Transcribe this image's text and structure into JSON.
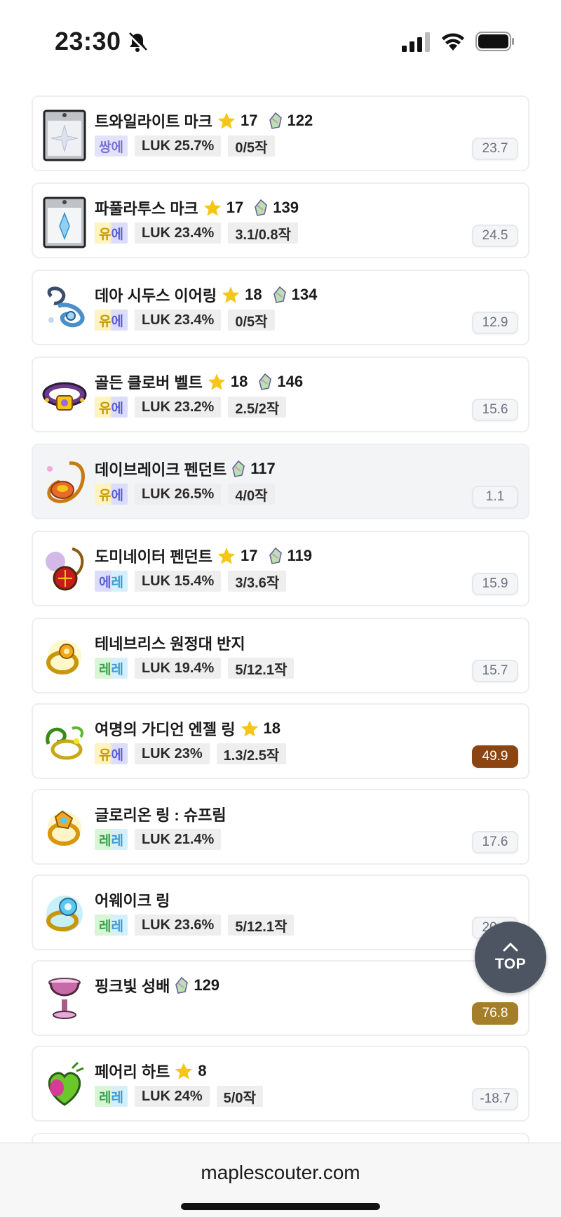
{
  "status_bar": {
    "time": "23:30"
  },
  "items": [
    {
      "name": "트와일라이트 마크",
      "star": "17",
      "gem": "122",
      "grade_a": "쌍",
      "grade_b": "에",
      "grade_class": "grade-mixed",
      "stat": "LUK 25.7%",
      "scroll": "0/5작",
      "score": "23.7",
      "score_style": "",
      "icon": "twilight-mark"
    },
    {
      "name": "파풀라투스 마크",
      "star": "17",
      "gem": "139",
      "grade_a": "유",
      "grade_b": "에",
      "grade_class": "grade-unique",
      "stat": "LUK 23.4%",
      "scroll": "3.1/0.8작",
      "score": "24.5",
      "score_style": "",
      "icon": "papulatus-mark"
    },
    {
      "name": "데아 시두스 이어링",
      "star": "18",
      "gem": "134",
      "grade_a": "유",
      "grade_b": "에",
      "grade_class": "grade-unique",
      "stat": "LUK 23.4%",
      "scroll": "0/5작",
      "score": "12.9",
      "score_style": "",
      "icon": "dea-sidus-earring"
    },
    {
      "name": "골든 클로버 벨트",
      "star": "18",
      "gem": "146",
      "grade_a": "유",
      "grade_b": "에",
      "grade_class": "grade-unique",
      "stat": "LUK 23.2%",
      "scroll": "2.5/2작",
      "score": "15.6",
      "score_style": "",
      "icon": "golden-clover-belt"
    },
    {
      "name": "데이브레이크 펜던트",
      "star": "",
      "gem": "117",
      "grade_a": "유",
      "grade_b": "에",
      "grade_class": "grade-unique",
      "stat": "LUK 26.5%",
      "scroll": "4/0작",
      "score": "1.1",
      "score_style": "",
      "icon": "daybreak-pendant",
      "highlight": true
    },
    {
      "name": "도미네이터 펜던트",
      "star": "17",
      "gem": "119",
      "grade_a": "에",
      "grade_b": "레",
      "grade_class": "grade-epic",
      "stat": "LUK 15.4%",
      "scroll": "3/3.6작",
      "score": "15.9",
      "score_style": "",
      "icon": "dominator-pendant"
    },
    {
      "name": "테네브리스 원정대 반지",
      "star": "",
      "gem": "",
      "grade_a": "레",
      "grade_b": "레",
      "grade_class": "grade-legend",
      "stat": "LUK 19.4%",
      "scroll": "5/12.1작",
      "score": "15.7",
      "score_style": "",
      "icon": "tenebris-ring"
    },
    {
      "name": "여명의 가디언 엔젤 링",
      "star": "18",
      "gem": "",
      "grade_a": "유",
      "grade_b": "에",
      "grade_class": "grade-unique",
      "stat": "LUK 23%",
      "scroll": "1.3/2.5작",
      "score": "49.9",
      "score_style": "hot",
      "icon": "guardian-angel-ring"
    },
    {
      "name": "글로리온 링 : 슈프림",
      "star": "",
      "gem": "",
      "grade_a": "레",
      "grade_b": "레",
      "grade_class": "grade-legend",
      "stat": "LUK 21.4%",
      "scroll": "",
      "score": "17.6",
      "score_style": "",
      "icon": "glorion-ring"
    },
    {
      "name": "어웨이크 링",
      "star": "",
      "gem": "",
      "grade_a": "레",
      "grade_b": "레",
      "grade_class": "grade-legend",
      "stat": "LUK 23.6%",
      "scroll": "5/12.1작",
      "score": "20.2",
      "score_style": "",
      "icon": "awake-ring"
    },
    {
      "name": "핑크빛 성배",
      "star": "",
      "gem": "129",
      "grade_a": "",
      "grade_b": "",
      "grade_class": "",
      "stat": "",
      "scroll": "",
      "score": "76.8",
      "score_style": "gold",
      "icon": "pink-holy-cup"
    },
    {
      "name": "페어리 하트",
      "star": "8",
      "gem": "",
      "grade_a": "레",
      "grade_b": "레",
      "grade_class": "grade-legend",
      "stat": "LUK 24%",
      "scroll": "5/0작",
      "score": "-18.7",
      "score_style": "",
      "icon": "fairy-heart"
    }
  ],
  "top_button": {
    "label": "TOP"
  },
  "bottom_bar": {
    "url": "maplescouter.com"
  },
  "colors": {
    "score_hot": "#8b4513",
    "score_gold": "#a57e2a",
    "top_button_bg": "#4d5562"
  }
}
